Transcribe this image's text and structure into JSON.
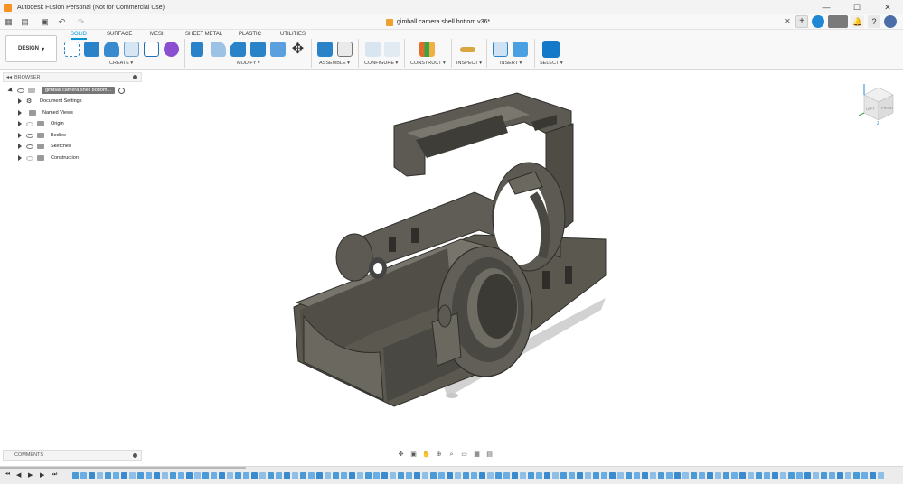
{
  "window": {
    "title": "Autodesk Fusion Personal (Not for Commercial Use)",
    "controls": [
      "—",
      "☐",
      "✕"
    ]
  },
  "document": {
    "tab_title": "gimball camera shell bottom v36*",
    "close_glyph": "✕"
  },
  "workspace": {
    "label": "DESIGN"
  },
  "tabs": [
    {
      "label": "SOLID",
      "active": true
    },
    {
      "label": "SURFACE",
      "active": false
    },
    {
      "label": "MESH",
      "active": false
    },
    {
      "label": "SHEET METAL",
      "active": false
    },
    {
      "label": "PLASTIC",
      "active": false
    },
    {
      "label": "UTILITIES",
      "active": false
    }
  ],
  "groups": [
    {
      "label": "CREATE ▾"
    },
    {
      "label": "MODIFY ▾"
    },
    {
      "label": "ASSEMBLE ▾"
    },
    {
      "label": "CONFIGURE ▾"
    },
    {
      "label": "CONSTRUCT ▾"
    },
    {
      "label": "INSPECT ▾"
    },
    {
      "label": "INSERT ▾"
    },
    {
      "label": "SELECT ▾"
    }
  ],
  "tools": [
    {
      "icon": "create-sketch-icon",
      "color": "#2a83c9"
    },
    {
      "icon": "extrude-icon",
      "color": "#2a83c9"
    },
    {
      "icon": "revolve-icon",
      "color": "#3a8ad0"
    },
    {
      "icon": "hole-icon",
      "color": "#6aa0cc"
    },
    {
      "icon": "pattern-icon",
      "color": "#1f6fb5"
    },
    {
      "icon": "form-icon",
      "color": "#8a4fd0"
    },
    {
      "icon": "press-pull-icon",
      "color": "#2a83c9"
    },
    {
      "icon": "fillet-icon",
      "color": "#2a83c9"
    },
    {
      "icon": "chamfer-icon",
      "color": "#2a83c9"
    },
    {
      "icon": "combine-icon",
      "color": "#2a83c9"
    },
    {
      "icon": "shell-icon",
      "color": "#2a83c9"
    },
    {
      "icon": "move-icon",
      "color": "#333333"
    },
    {
      "icon": "new-component-icon",
      "color": "#2a83c9"
    },
    {
      "icon": "joint-icon",
      "color": "#777777"
    },
    {
      "icon": "configure-icon",
      "color": "#b6cfe6"
    },
    {
      "icon": "configure-table-icon",
      "color": "#c7d6e3"
    },
    {
      "icon": "offset-plane-icon",
      "color": "#3aa34a"
    },
    {
      "icon": "measure-icon",
      "color": "#d9a640"
    },
    {
      "icon": "insert-derive-icon",
      "color": "#2a83c9"
    },
    {
      "icon": "insert-image-icon",
      "color": "#2a83c9"
    },
    {
      "icon": "select-icon",
      "color": "#1479c9"
    }
  ],
  "browser": {
    "header": "BROWSER",
    "root_label": "gimball camera shell bottom...",
    "items": [
      {
        "label": "Document Settings",
        "icon": "gear-icon"
      },
      {
        "label": "Named Views",
        "icon": "folder-icon"
      },
      {
        "label": "Origin",
        "icon": "folder-icon"
      },
      {
        "label": "Bodies",
        "icon": "folder-icon"
      },
      {
        "label": "Sketches",
        "icon": "folder-icon"
      },
      {
        "label": "Construction",
        "icon": "folder-icon"
      }
    ]
  },
  "viewcube": {
    "faces": [
      "LEFT",
      "FRONT"
    ],
    "axis_label": "Z"
  },
  "comments": {
    "header": "COMMENTS"
  },
  "timeline": {
    "controls": [
      "⏮",
      "◀",
      "▶",
      "▶",
      "⏭"
    ],
    "feature_count": 100
  },
  "colors": {
    "accent": "#0696d7",
    "model_body": "#5c5a52",
    "model_shadow": "#d2d2d2"
  }
}
